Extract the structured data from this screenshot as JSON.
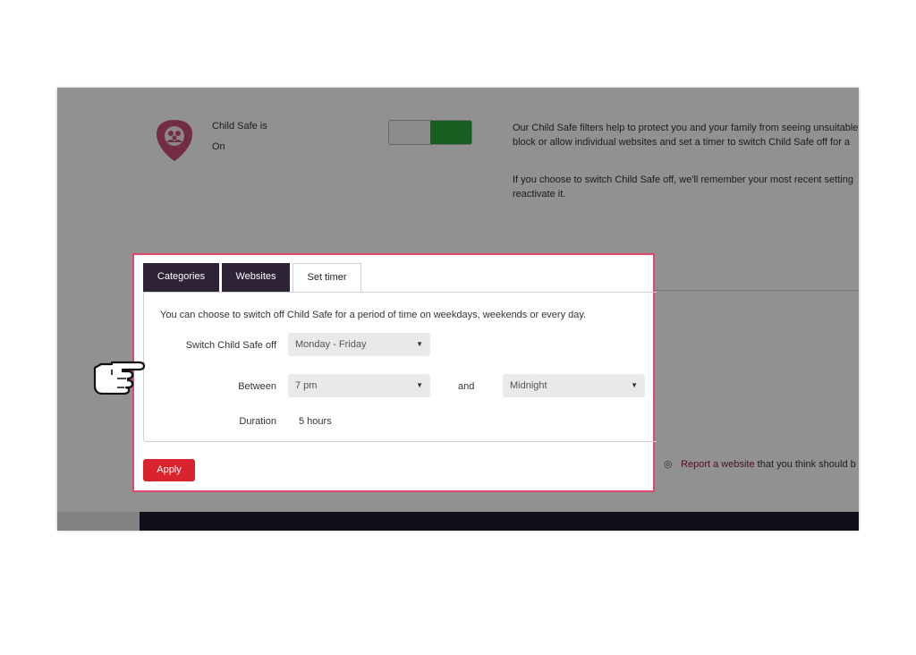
{
  "child_safe": {
    "status_title": "Child Safe is",
    "status_value": "On",
    "toggle_on": true,
    "info_lines": [
      "Our Child Safe filters help to protect you and your family from seeing unsuitable",
      "block or allow individual websites and set a timer to switch Child Safe off for a"
    ],
    "info2_line1": "If you choose to switch Child Safe off, we'll remember your most recent setting",
    "info2_line2": "reactivate it."
  },
  "tabs": [
    {
      "label": "Categories",
      "active": false
    },
    {
      "label": "Websites",
      "active": false
    },
    {
      "label": "Set timer",
      "active": true
    }
  ],
  "timer": {
    "description": "You can choose to switch off Child Safe for a period of time on weekdays, weekends or every day.",
    "switch_label": "Switch Child Safe off",
    "switch_value": "Monday - Friday",
    "between_label": "Between",
    "start_value": "7 pm",
    "and_label": "and",
    "end_value": "Midnight",
    "duration_label": "Duration",
    "duration_value": "5 hours"
  },
  "apply_label": "Apply",
  "report": {
    "link": "Report a website",
    "rest": "that you think should b"
  },
  "colors": {
    "accent": "#e0486e",
    "apply": "#d9232e",
    "tab_dark": "#2d2236",
    "toggle_on": "#29a839"
  },
  "icons": {
    "shield": "family-shield-icon",
    "caret": "chevron-down-icon",
    "eye": "eye-icon",
    "hand": "pointing-hand-cursor-icon"
  }
}
